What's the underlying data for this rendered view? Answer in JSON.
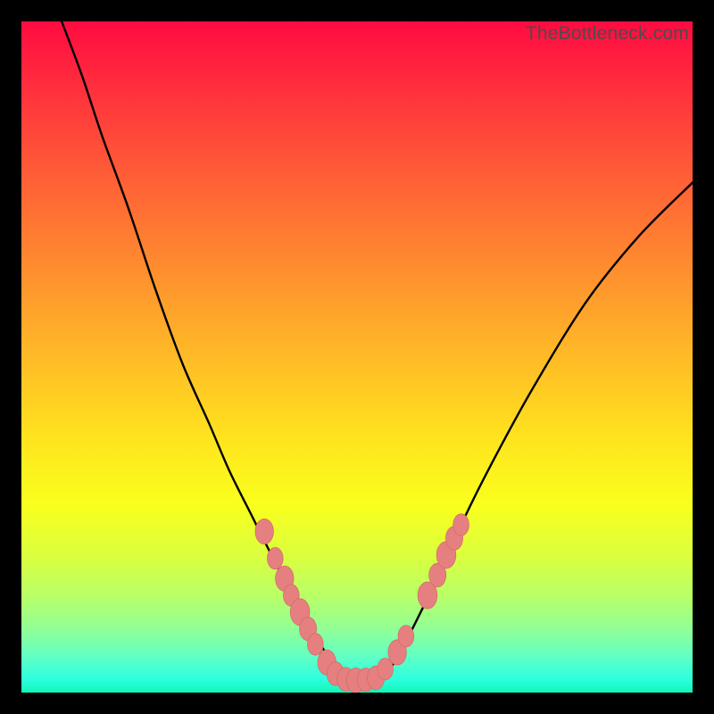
{
  "watermark": {
    "text": "TheBottleneck.com"
  },
  "chart_data": {
    "type": "line",
    "title": "",
    "xlabel": "",
    "ylabel": "",
    "xlim": [
      0,
      100
    ],
    "ylim": [
      0,
      100
    ],
    "grid": false,
    "series": [
      {
        "name": "curve",
        "x": [
          6,
          9,
          12,
          16,
          20,
          24,
          28,
          31,
          34,
          36,
          38,
          40,
          42,
          44,
          46,
          48,
          50,
          52,
          54,
          56,
          58,
          60,
          63,
          66,
          70,
          76,
          84,
          92,
          100
        ],
        "y": [
          100,
          92,
          83,
          72,
          60,
          49,
          40,
          33,
          27,
          23,
          19,
          15,
          11,
          8,
          5,
          3,
          2,
          2,
          3,
          5,
          9,
          13,
          19,
          26,
          34,
          45,
          58,
          68,
          76
        ]
      }
    ],
    "markers": [
      {
        "x": 36.2,
        "y": 24.0,
        "r": 1.5
      },
      {
        "x": 37.8,
        "y": 20.0,
        "r": 1.3
      },
      {
        "x": 39.2,
        "y": 17.0,
        "r": 1.5
      },
      {
        "x": 40.2,
        "y": 14.5,
        "r": 1.3
      },
      {
        "x": 41.5,
        "y": 12.0,
        "r": 1.6
      },
      {
        "x": 42.7,
        "y": 9.5,
        "r": 1.4
      },
      {
        "x": 43.8,
        "y": 7.2,
        "r": 1.3
      },
      {
        "x": 45.5,
        "y": 4.5,
        "r": 1.5
      },
      {
        "x": 46.8,
        "y": 2.8,
        "r": 1.4
      },
      {
        "x": 48.3,
        "y": 2.0,
        "r": 1.4
      },
      {
        "x": 49.8,
        "y": 1.8,
        "r": 1.5
      },
      {
        "x": 51.3,
        "y": 1.9,
        "r": 1.4
      },
      {
        "x": 52.8,
        "y": 2.2,
        "r": 1.4
      },
      {
        "x": 54.2,
        "y": 3.5,
        "r": 1.3
      },
      {
        "x": 56.0,
        "y": 6.0,
        "r": 1.5
      },
      {
        "x": 57.3,
        "y": 8.4,
        "r": 1.3
      },
      {
        "x": 60.5,
        "y": 14.5,
        "r": 1.6
      },
      {
        "x": 62.0,
        "y": 17.5,
        "r": 1.4
      },
      {
        "x": 63.3,
        "y": 20.5,
        "r": 1.6
      },
      {
        "x": 64.5,
        "y": 23.0,
        "r": 1.4
      },
      {
        "x": 65.5,
        "y": 25.0,
        "r": 1.3
      }
    ],
    "colors": {
      "curve": "#000000",
      "marker_fill": "#e68080",
      "marker_stroke": "#d46b6b"
    }
  }
}
